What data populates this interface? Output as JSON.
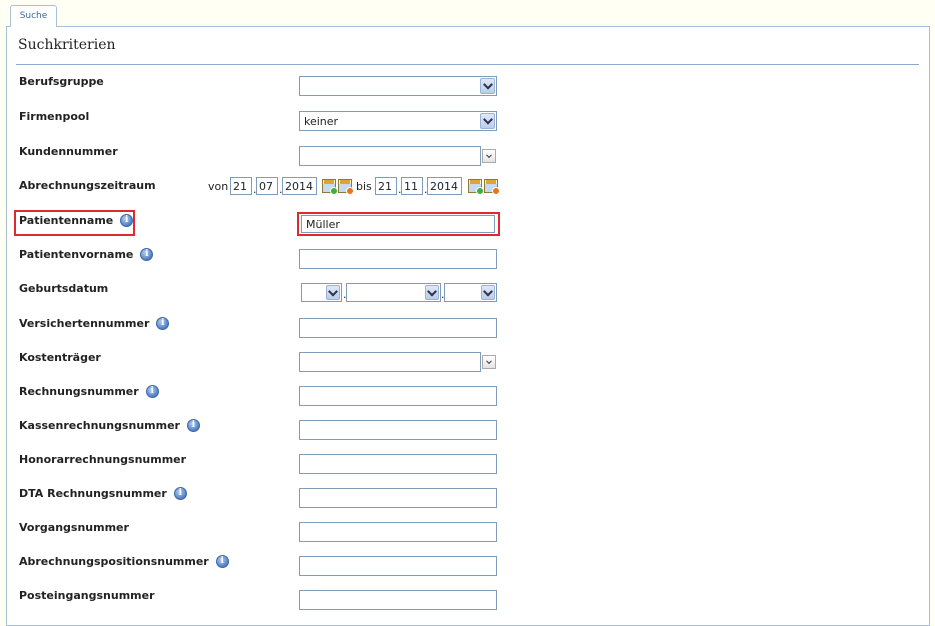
{
  "tab": {
    "label": "Suche"
  },
  "panel": {
    "title": "Suchkriterien"
  },
  "fields": {
    "berufsgruppe": {
      "label": "Berufsgruppe",
      "value": ""
    },
    "firmenpool": {
      "label": "Firmenpool",
      "value": "keiner"
    },
    "kundennummer": {
      "label": "Kundennummer",
      "value": ""
    },
    "abrechnungszeitraum": {
      "label": "Abrechnungszeitraum",
      "from_word": "von",
      "to_word": "bis",
      "from": {
        "day": "21",
        "month": "07",
        "year": "2014"
      },
      "to": {
        "day": "21",
        "month": "11",
        "year": "2014"
      }
    },
    "patientenname": {
      "label": "Patientenname",
      "value": "Müller"
    },
    "patientenvorname": {
      "label": "Patientenvorname",
      "value": ""
    },
    "geburtsdatum": {
      "label": "Geburtsdatum"
    },
    "versichertennummer": {
      "label": "Versichertennummer",
      "value": ""
    },
    "kostentraeger": {
      "label": "Kostenträger",
      "value": ""
    },
    "rechnungsnummer": {
      "label": "Rechnungsnummer",
      "value": ""
    },
    "kassenrechnungsnummer": {
      "label": "Kassenrechnungsnummer",
      "value": ""
    },
    "honorarrechnungsnummer": {
      "label": "Honorarrechnungsnummer",
      "value": ""
    },
    "dta_rechnungsnummer": {
      "label": "DTA Rechnungsnummer",
      "value": ""
    },
    "vorgangsnummer": {
      "label": "Vorgangsnummer",
      "value": ""
    },
    "abrechnungspositionsnummer": {
      "label": "Abrechnungspositionsnummer",
      "value": ""
    },
    "posteingangsnummer": {
      "label": "Posteingangsnummer",
      "value": ""
    }
  },
  "info_icon_glyph": "i",
  "highlight_color": "#e0282f"
}
